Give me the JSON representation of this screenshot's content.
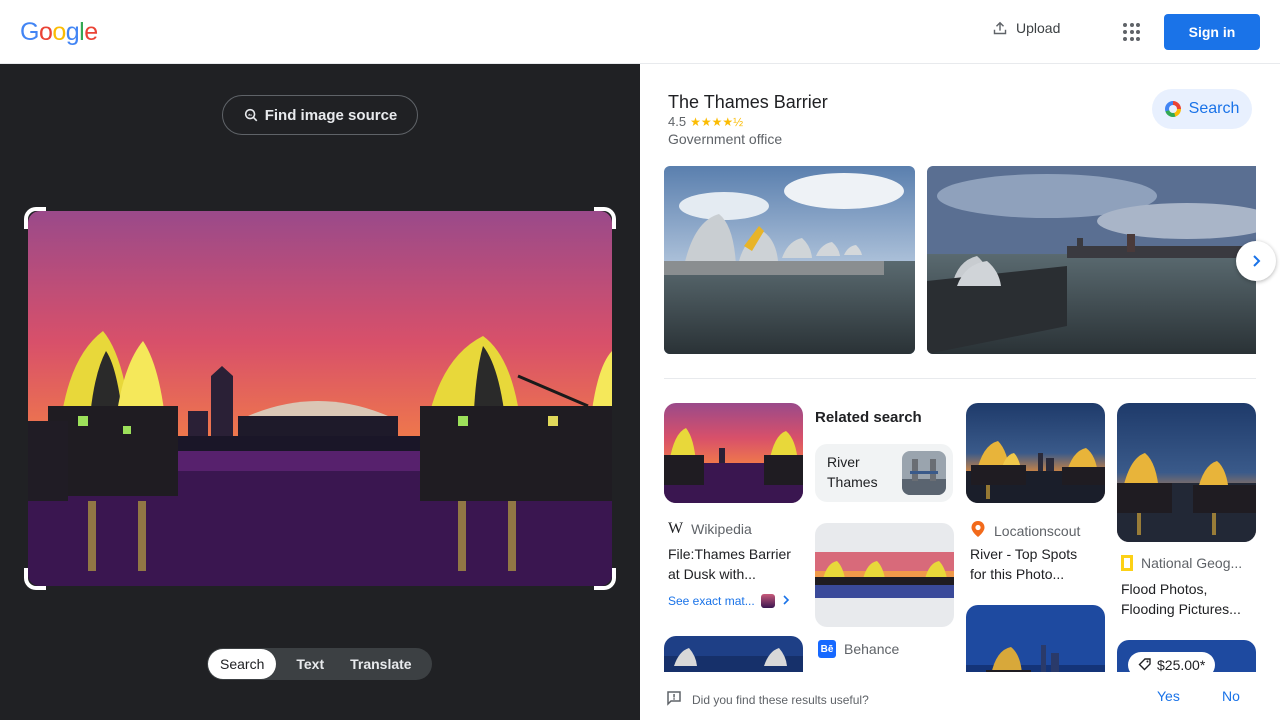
{
  "header": {
    "logo": "Google",
    "upload_label": "Upload",
    "apps_icon": "apps-grid-icon",
    "signin_label": "Sign in"
  },
  "lens": {
    "find_source_label": "Find image source",
    "modes": [
      {
        "label": "Search",
        "active": true
      },
      {
        "label": "Text",
        "active": false
      },
      {
        "label": "Translate",
        "active": false
      }
    ]
  },
  "knowledge_panel": {
    "title": "The Thames Barrier",
    "rating": "4.5",
    "stars": "★★★★½",
    "type": "Government office",
    "search_label": "Search"
  },
  "related": {
    "heading": "Related search",
    "chip_label_line1": "River",
    "chip_label_line2": "Thames"
  },
  "results": [
    {
      "source": "Wikipedia",
      "title_line1": "File:Thames Barrier",
      "title_line2": "at Dusk with...",
      "exact_label": "See exact mat..."
    },
    {
      "source": "Locationscout",
      "title_line1": "River - Top Spots",
      "title_line2": "for this Photo..."
    },
    {
      "source": "National Geog...",
      "title_line1": "Flood Photos,",
      "title_line2": "Flooding Pictures..."
    },
    {
      "source": "Behance",
      "title_line1": "",
      "title_line2": ""
    }
  ],
  "price_badge": "$25.00*",
  "feedback": {
    "question": "Did you find these results useful?",
    "yes": "Yes",
    "no": "No"
  },
  "colors": {
    "accent": "#1a73e8",
    "left_bg": "#202124"
  }
}
